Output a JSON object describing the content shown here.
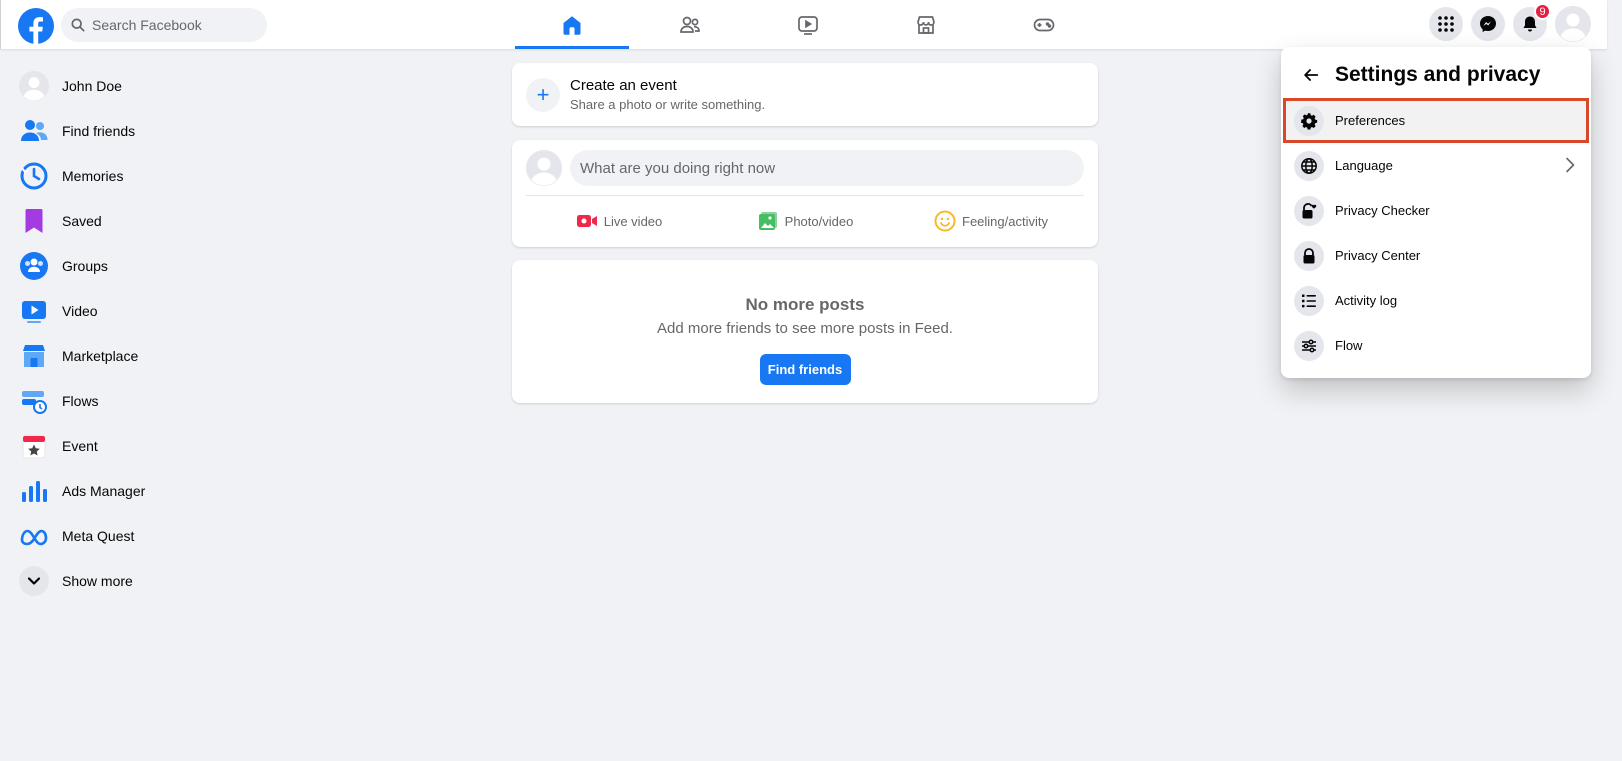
{
  "search": {
    "placeholder": "Search Facebook"
  },
  "nav": {
    "tabs": [
      "home",
      "friends",
      "watch",
      "marketplace",
      "gaming"
    ]
  },
  "topbar": {
    "notification_count": "9"
  },
  "sidebar": {
    "items": [
      {
        "label": "John Doe",
        "icon": "avatar"
      },
      {
        "label": "Find friends",
        "icon": "friends-icon"
      },
      {
        "label": "Memories",
        "icon": "memories-icon"
      },
      {
        "label": "Saved",
        "icon": "saved-icon"
      },
      {
        "label": "Groups",
        "icon": "groups-icon"
      },
      {
        "label": "Video",
        "icon": "video-icon"
      },
      {
        "label": "Marketplace",
        "icon": "marketplace-icon"
      },
      {
        "label": "Flows",
        "icon": "flows-icon"
      },
      {
        "label": "Event",
        "icon": "event-icon"
      },
      {
        "label": "Ads Manager",
        "icon": "ads-manager-icon"
      },
      {
        "label": "Meta Quest",
        "icon": "meta-quest-icon"
      },
      {
        "label": "Show more",
        "icon": "chevron-down-icon"
      }
    ]
  },
  "create_event": {
    "title": "Create an event",
    "subtitle": "Share a photo or write something."
  },
  "composer": {
    "placeholder": "What are you doing right now",
    "actions": {
      "live": "Live video",
      "photo": "Photo/video",
      "feeling": "Feeling/activity"
    }
  },
  "feed_end": {
    "title": "No more posts",
    "subtitle": "Add more friends to see more posts in Feed.",
    "button": "Find friends"
  },
  "settings_menu": {
    "title": "Settings and privacy",
    "items": [
      {
        "label": "Preferences",
        "icon": "gear-icon"
      },
      {
        "label": "Language",
        "icon": "globe-icon"
      },
      {
        "label": "Privacy Checker",
        "icon": "lock-heart-icon"
      },
      {
        "label": "Privacy Center",
        "icon": "lock-icon"
      },
      {
        "label": "Activity log",
        "icon": "list-icon"
      },
      {
        "label": "Flow",
        "icon": "sliders-icon"
      }
    ]
  },
  "colors": {
    "brand": "#1877f2",
    "highlight": "#d9482b",
    "badge": "#e41e3f"
  }
}
